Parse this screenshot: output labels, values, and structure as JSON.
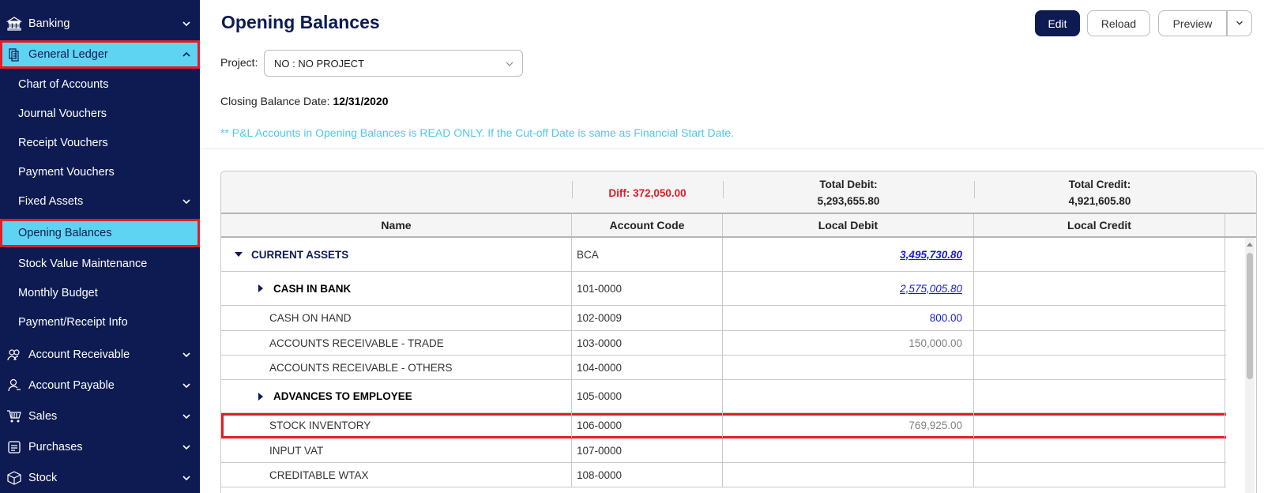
{
  "sidebar": {
    "items": [
      {
        "label": "Banking",
        "icon": "bank-icon"
      },
      {
        "label": "General Ledger",
        "icon": "ledger-icon"
      },
      {
        "label": "Chart of Accounts"
      },
      {
        "label": "Journal Vouchers"
      },
      {
        "label": "Receipt Vouchers"
      },
      {
        "label": "Payment Vouchers"
      },
      {
        "label": "Fixed Assets"
      },
      {
        "label": "Opening Balances"
      },
      {
        "label": "Stock Value Maintenance"
      },
      {
        "label": "Monthly Budget"
      },
      {
        "label": "Payment/Receipt Info"
      },
      {
        "label": "Account Receivable",
        "icon": "receivable-icon"
      },
      {
        "label": "Account Payable",
        "icon": "payable-icon"
      },
      {
        "label": "Sales",
        "icon": "cart-icon"
      },
      {
        "label": "Purchases",
        "icon": "purchases-icon"
      },
      {
        "label": "Stock",
        "icon": "box-icon"
      }
    ]
  },
  "header": {
    "title": "Opening Balances",
    "buttons": {
      "edit": "Edit",
      "reload": "Reload",
      "preview": "Preview"
    }
  },
  "filters": {
    "project_label": "Project:",
    "project_value": "NO : NO PROJECT",
    "closing_label": "Closing Balance Date:",
    "closing_value": "12/31/2020",
    "note": "** P&L Accounts in Opening Balances is READ ONLY. If the Cut-off Date is same as Financial Start Date."
  },
  "summary": {
    "diff": "Diff: 372,050.00",
    "total_debit_label": "Total Debit:",
    "total_debit_value": "5,293,655.80",
    "total_credit_label": "Total Credit:",
    "total_credit_value": "4,921,605.80"
  },
  "table": {
    "columns": [
      "Name",
      "Account Code",
      "Local Debit",
      "Local Credit"
    ],
    "rows": [
      {
        "name": "CURRENT ASSETS",
        "code": "BCA",
        "debit": "3,495,730.80",
        "credit": ""
      },
      {
        "name": "CASH IN BANK",
        "code": "101-0000",
        "debit": "2,575,005.80",
        "credit": ""
      },
      {
        "name": "CASH ON HAND",
        "code": "102-0009",
        "debit": "800.00",
        "credit": ""
      },
      {
        "name": "ACCOUNTS RECEIVABLE - TRADE",
        "code": "103-0000",
        "debit": "150,000.00",
        "credit": ""
      },
      {
        "name": "ACCOUNTS RECEIVABLE - OTHERS",
        "code": "104-0000",
        "debit": "",
        "credit": ""
      },
      {
        "name": "ADVANCES TO EMPLOYEE",
        "code": "105-0000",
        "debit": "",
        "credit": ""
      },
      {
        "name": "STOCK INVENTORY",
        "code": "106-0000",
        "debit": "769,925.00",
        "credit": ""
      },
      {
        "name": "INPUT VAT",
        "code": "107-0000",
        "debit": "",
        "credit": ""
      },
      {
        "name": "CREDITABLE WTAX",
        "code": "108-0000",
        "debit": "",
        "credit": ""
      }
    ]
  },
  "colors": {
    "navy": "#0d1b52",
    "active": "#5fd4f2",
    "highlight": "#e11d25",
    "note": "#4fc8e6",
    "link": "#1a1ad6"
  }
}
